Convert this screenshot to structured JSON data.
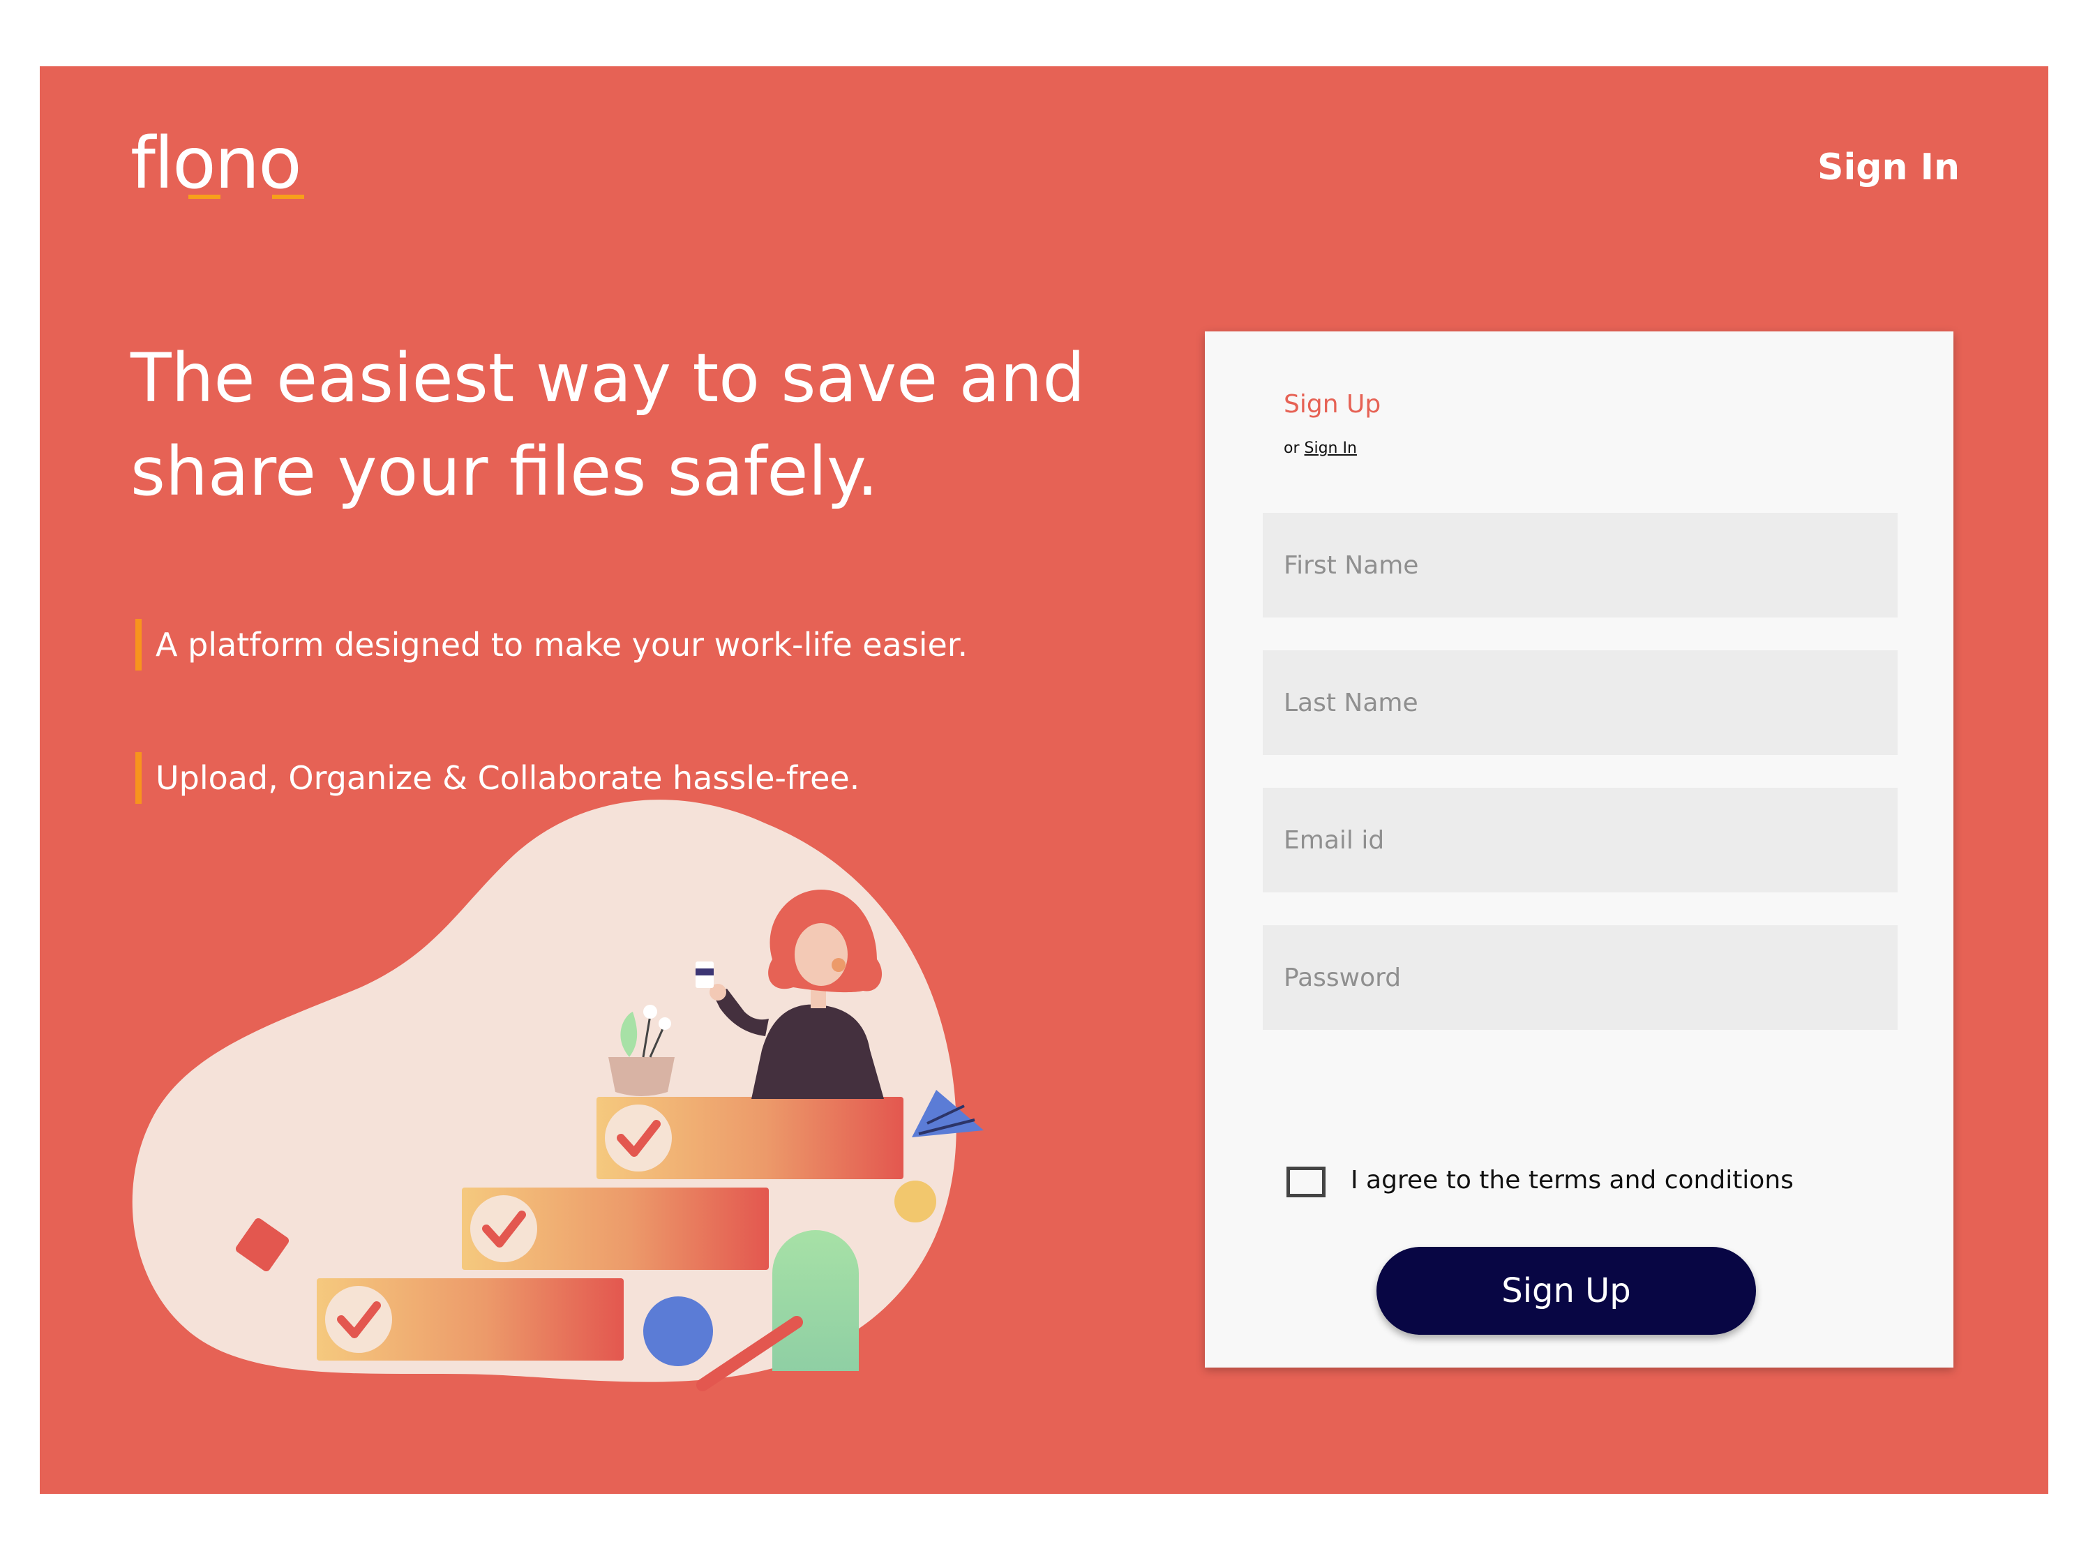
{
  "brand": {
    "logo_text": "flono"
  },
  "nav": {
    "sign_in_label": "Sign In"
  },
  "hero": {
    "headline": "The easiest way to save and share your files safely.",
    "taglines": [
      "A platform designed to make your work-life easier.",
      "Upload, Organize & Collaborate hassle-free."
    ]
  },
  "signup_form": {
    "title": "Sign Up",
    "or_prefix": "or",
    "sign_in_link": "Sign In",
    "fields": {
      "first_name": {
        "placeholder": "First Name",
        "value": ""
      },
      "last_name": {
        "placeholder": "Last Name",
        "value": ""
      },
      "email": {
        "placeholder": "Email id",
        "value": ""
      },
      "password": {
        "placeholder": "Password",
        "value": ""
      }
    },
    "agree_label": "I agree to the terms and conditions",
    "agree_checked": false,
    "submit_label": "Sign Up"
  },
  "colors": {
    "hero_background": "#e66255",
    "accent_orange": "#f7941d",
    "card_background": "#f8f8f8",
    "field_background": "#ececec",
    "button_background": "#080644"
  },
  "icons": [
    "checkmark-icon",
    "checkmark-icon",
    "checkmark-icon"
  ]
}
